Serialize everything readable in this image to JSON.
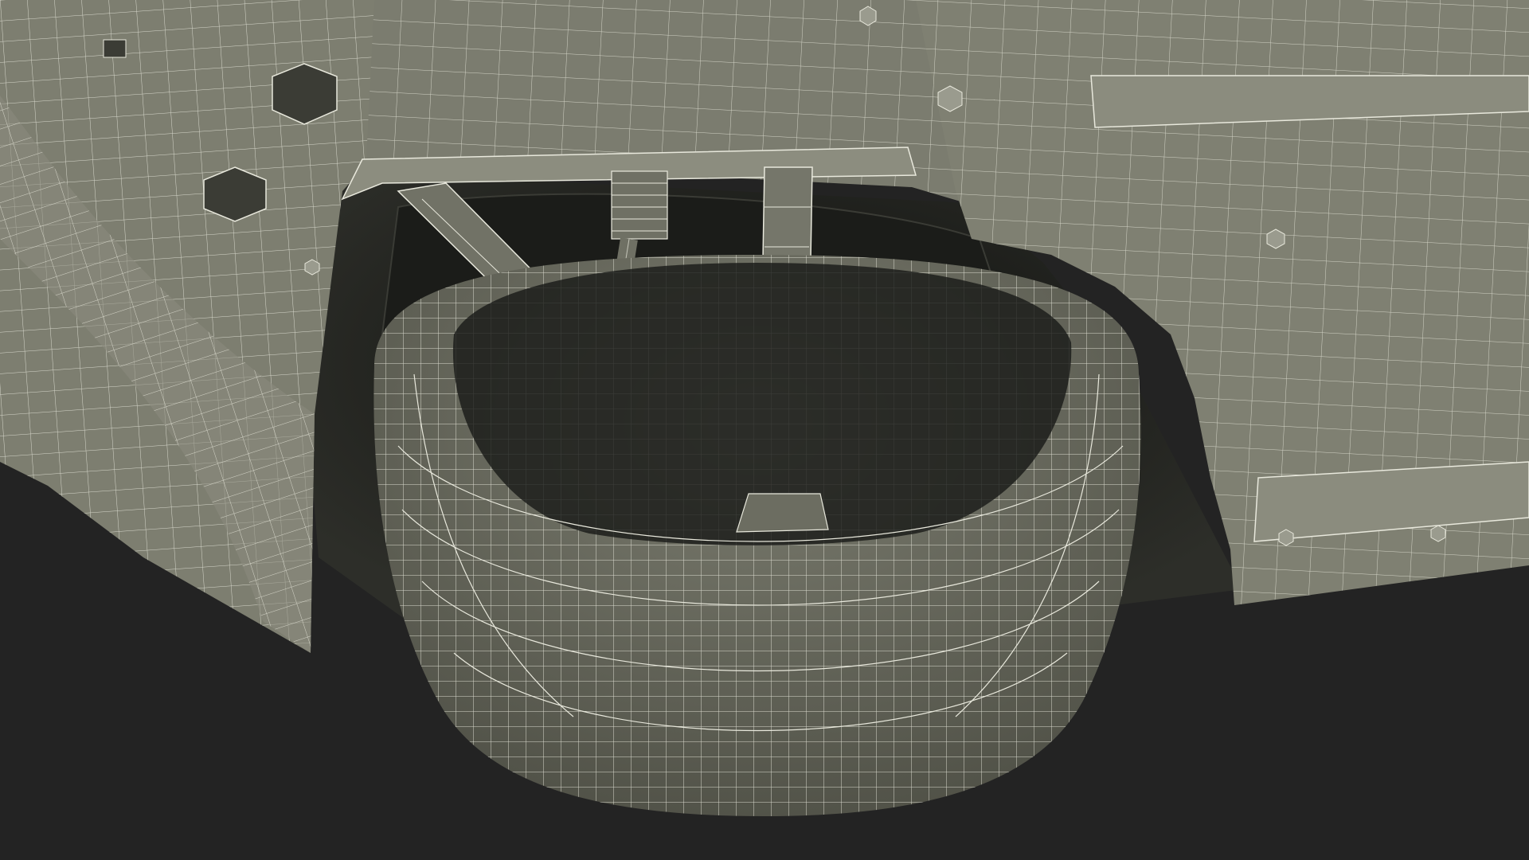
{
  "scene": {
    "subject": "wireframe-render-vehicle-wheel-well",
    "colors": {
      "background": "#232323",
      "body_panel": "#7d7e70",
      "body_panel_light": "#8a8b7d",
      "body_shadow": "#5d5e53",
      "cavity": "#141513",
      "cavity_mid": "#2a2b27",
      "tire": "#6e6f63",
      "tire_dark": "#55564c",
      "suspension": "#6f7064",
      "wire": "#e8e8dc"
    }
  }
}
